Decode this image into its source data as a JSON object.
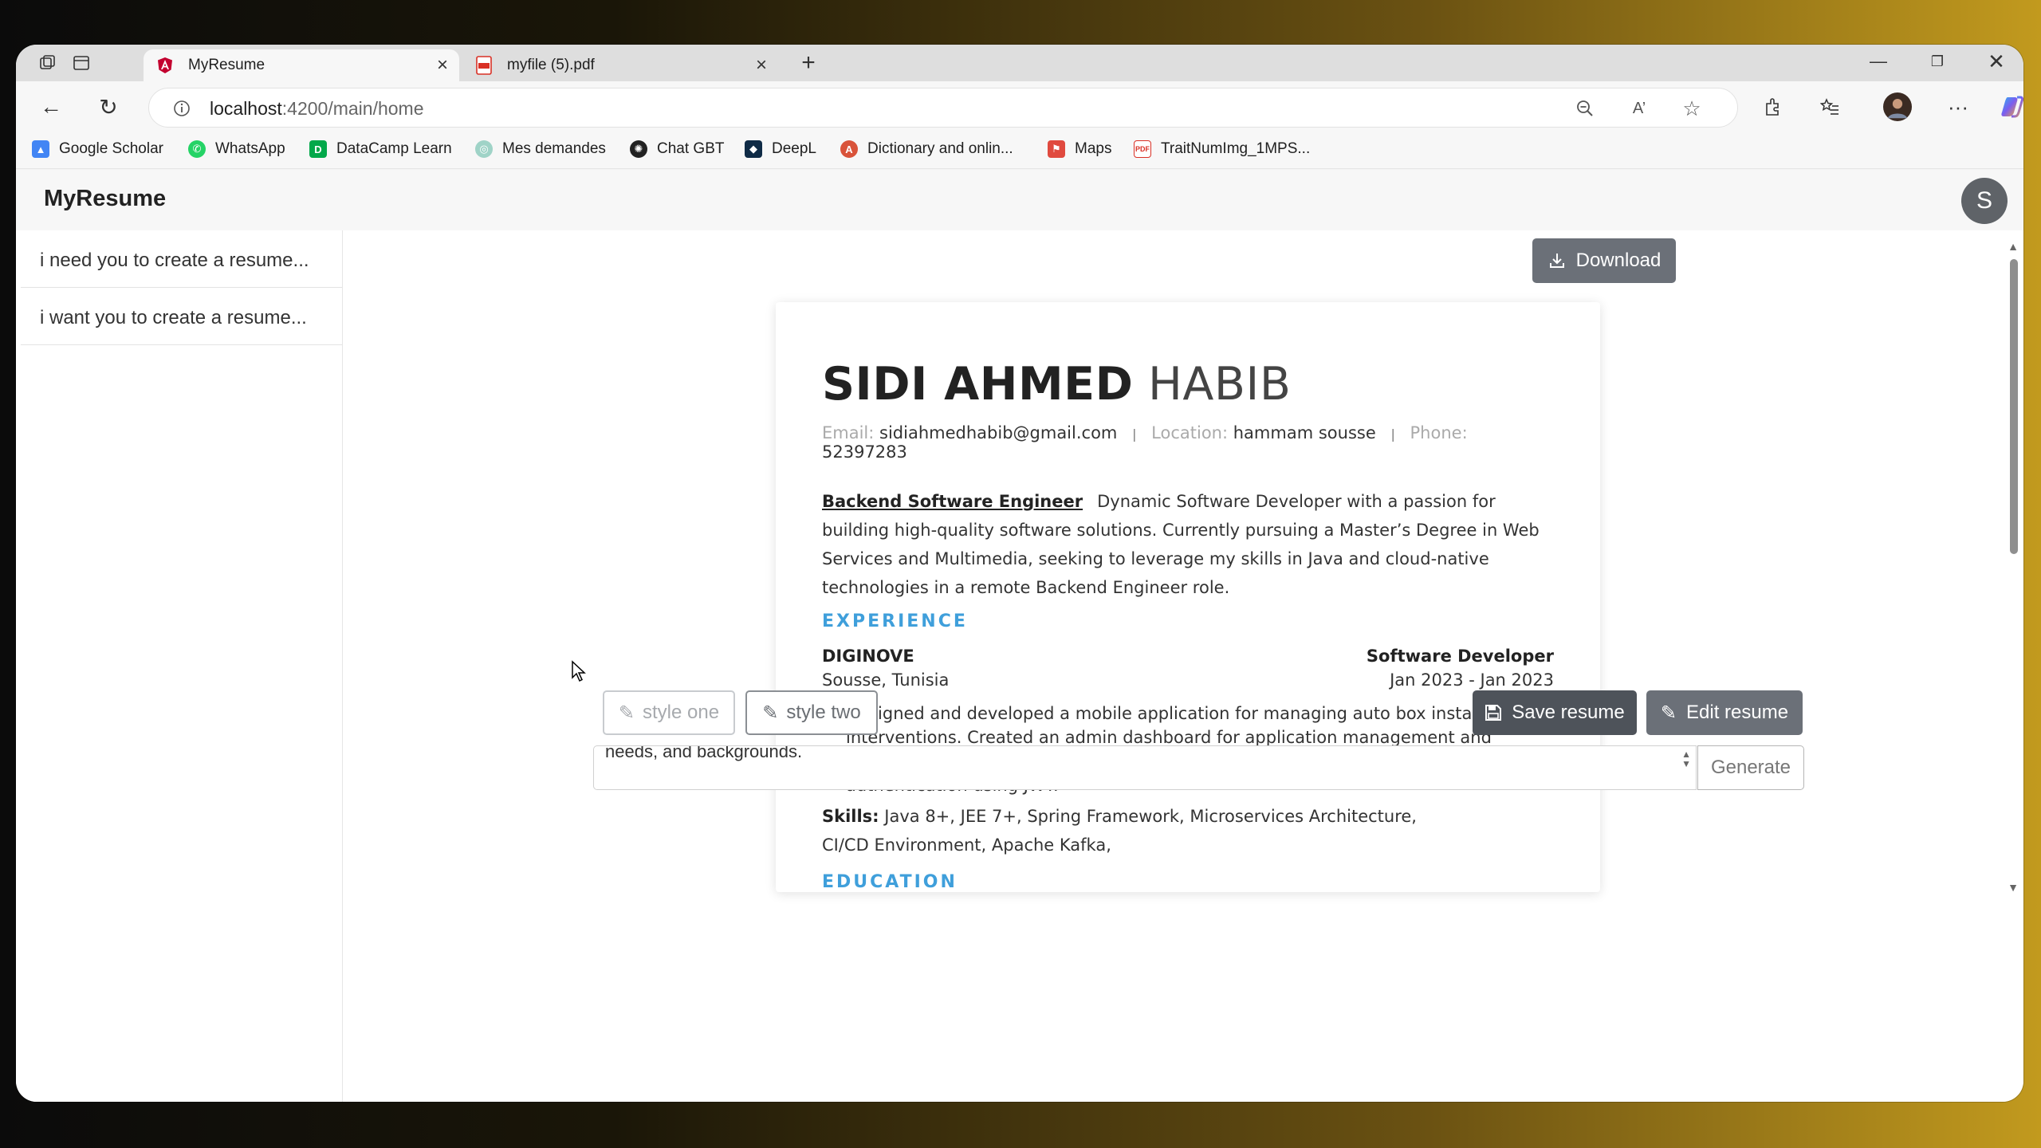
{
  "browser": {
    "tabs": [
      {
        "title": "MyResume",
        "favicon": "angular-icon"
      },
      {
        "title": "myfile (5).pdf",
        "favicon": "pdf-icon"
      }
    ],
    "url_host": "localhost",
    "url_path": ":4200/main/home",
    "bookmarks": [
      {
        "label": "Google Scholar",
        "icon": "google-scholar-icon",
        "color": "#4285f4"
      },
      {
        "label": "WhatsApp",
        "icon": "whatsapp-icon",
        "color": "#25d366"
      },
      {
        "label": "DataCamp Learn",
        "icon": "datacamp-icon",
        "color": "#03ef62"
      },
      {
        "label": "Mes demandes",
        "icon": "mes-demandes-icon",
        "color": "#9fd3c7"
      },
      {
        "label": "Chat GBT",
        "icon": "chatgpt-icon",
        "color": "#222222"
      },
      {
        "label": "DeepL",
        "icon": "deepl-icon",
        "color": "#0f2b46"
      },
      {
        "label": "Dictionary and onlin...",
        "icon": "dictionary-icon",
        "color": "#d9533a"
      },
      {
        "label": "Maps",
        "icon": "maps-icon",
        "color": "#e04a3f"
      },
      {
        "label": "TraitNumImg_1MPS...",
        "icon": "pdf-icon",
        "color": "#d93025"
      }
    ]
  },
  "app": {
    "brand": "MyResume",
    "avatar_letter": "S",
    "sidebar": {
      "items": [
        {
          "label": "i need you to create a resume..."
        },
        {
          "label": "i want you to create a resume..."
        }
      ]
    },
    "download_label": "Download",
    "style_buttons": [
      {
        "label": "style one"
      },
      {
        "label": "style two"
      }
    ],
    "save_label": "Save resume",
    "edit_label": "Edit resume",
    "prompt_text": "needs, and backgrounds.",
    "generate_label": "Generate"
  },
  "resume": {
    "first_name": "SIDI AHMED",
    "last_name": "HABIB",
    "contact": {
      "email_label": "Email:",
      "email": "sidiahmedhabib@gmail.com",
      "location_label": "Location:",
      "location": "hammam sousse",
      "phone_label": "Phone:",
      "phone": "52397283"
    },
    "role": "Backend Software Engineer",
    "summary": "Dynamic Software Developer with a passion for building high-quality software solutions. Currently pursuing a Master’s Degree in Web Services and Multimedia, seeking to leverage my skills in Java and cloud-native technologies in a remote Backend Engineer role.",
    "experience_heading": "EXPERIENCE",
    "job": {
      "company": "DIGINOVE",
      "location": "Sousse, Tunisia",
      "title": "Software Developer",
      "dates": "Jan 2023 - Jan 2023",
      "bullet": "Designed and developed a mobile application for managing auto box installation interventions. Created an admin dashboard for application management and developed a module for managing data sources. Implemented stateless authentication using JWT.",
      "skills_label": "Skills:",
      "skills": "Java 8+, JEE 7+, Spring Framework, Microservices Architecture, CI/CD Environment, Apache Kafka,"
    },
    "education_heading": "EDUCATION"
  },
  "colors": {
    "accent": "#3f9fdb",
    "button_dark": "#4e535a",
    "button_download": "#6b7078"
  }
}
